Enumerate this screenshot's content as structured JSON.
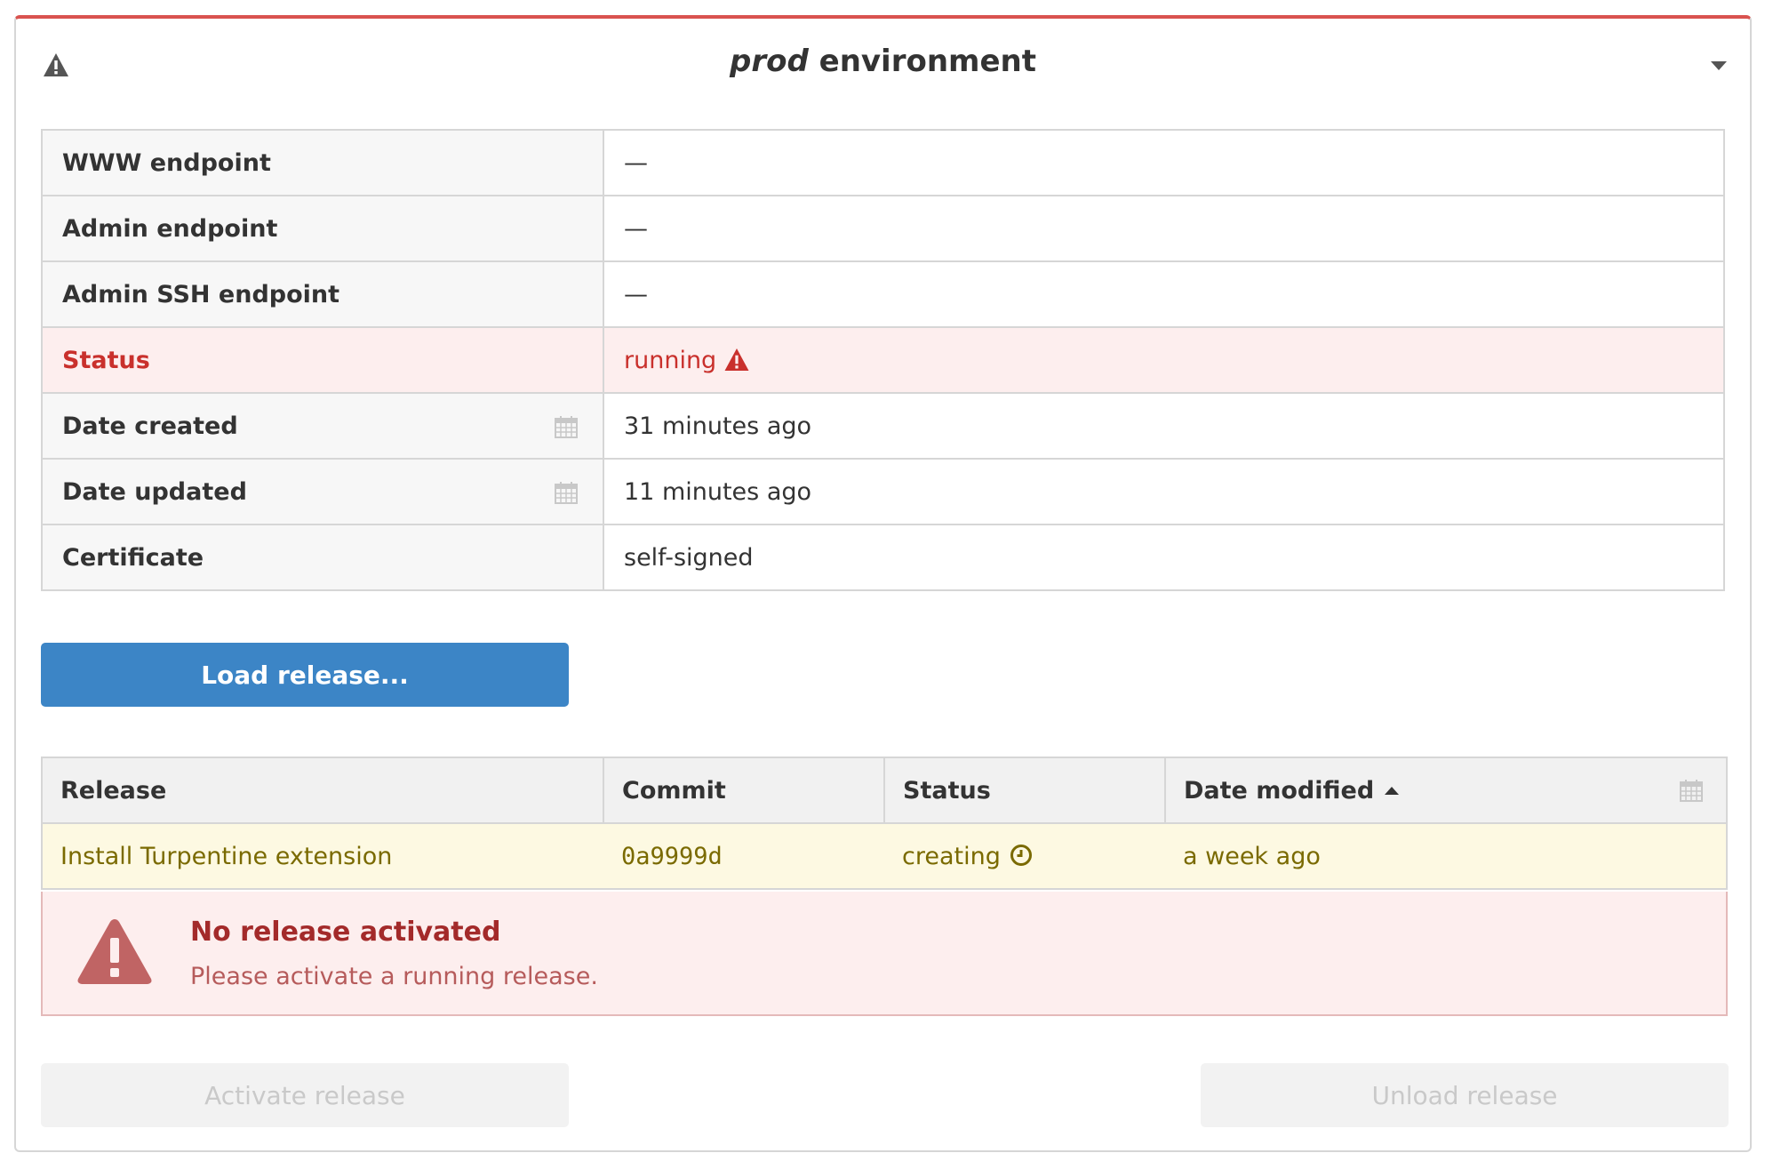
{
  "header": {
    "title_em": "prod",
    "title_rest": " environment",
    "warning_icon": "warning-icon",
    "collapse_icon": "chevron-down-icon"
  },
  "info": {
    "rows": [
      {
        "key": "WWW endpoint",
        "value": "—"
      },
      {
        "key": "Admin endpoint",
        "value": "—"
      },
      {
        "key": "Admin SSH endpoint",
        "value": "—"
      },
      {
        "key": "Status",
        "value": "running"
      },
      {
        "key": "Date created",
        "value": "31 minutes ago"
      },
      {
        "key": "Date updated",
        "value": "11 minutes ago"
      },
      {
        "key": "Certificate",
        "value": "self-signed"
      }
    ]
  },
  "buttons": {
    "load_release": "Load release...",
    "activate_release": "Activate release",
    "unload_release": "Unload release"
  },
  "releases": {
    "columns": [
      "Release",
      "Commit",
      "Status",
      "Date modified"
    ],
    "rows": [
      {
        "release": "Install Turpentine extension",
        "commit": "0a9999d",
        "status": "creating",
        "date_modified": "a week ago"
      }
    ]
  },
  "alert": {
    "title": "No release activated",
    "text": "Please activate a running release."
  },
  "colors": {
    "danger": "#d9534f",
    "primary": "#3c85c6",
    "warning_row": "#fdf9e2",
    "danger_row": "#fdeeee"
  }
}
